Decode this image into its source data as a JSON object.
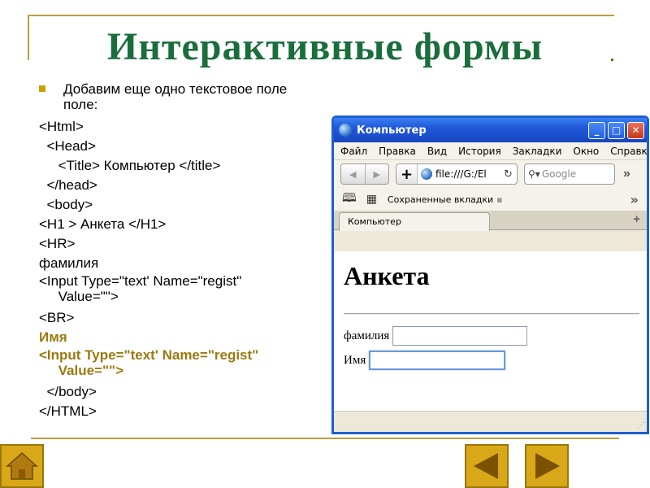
{
  "slide": {
    "title": "Интерактивные формы",
    "bullet": "Добавим еще одно текстовое поле поле:",
    "code_lines": [
      "<Html>",
      "  <Head>",
      "     <Title> Компьютер </title>",
      "  </head>",
      "  <body>",
      "<H1 > Анкета </H1>",
      "<HR>",
      "фамилия",
      "<Input Type=\"text' Name=\"regist\"",
      "     Value=\"\">",
      "<BR>",
      "Имя",
      "<Input Type=\"text' Name=\"regist\"",
      "     Value=\"\">",
      "  </body>",
      "</HTML>"
    ],
    "colors": {
      "title": "#1a6e3c",
      "highlight": "#9a7a10",
      "accent": "#d8a818",
      "frame": "#b8a040"
    }
  },
  "browser": {
    "window_title": "Компьютер",
    "window_buttons": {
      "minimize": "_",
      "maximize": "□",
      "close": "✕"
    },
    "menu": [
      "Файл",
      "Правка",
      "Вид",
      "История",
      "Закладки",
      "Окно",
      "Справка"
    ],
    "url": "file:///G:/El",
    "search_placeholder": "Google",
    "bookmarks_label": "Сохраненные вкладки",
    "tab_label": "Компьютер",
    "page": {
      "heading": "Анкета",
      "field1_label": "фамилия",
      "field2_label": "Имя"
    }
  },
  "nav": {
    "home_icon": "home-icon",
    "prev_icon": "arrow-left-icon",
    "next_icon": "arrow-right-icon"
  }
}
